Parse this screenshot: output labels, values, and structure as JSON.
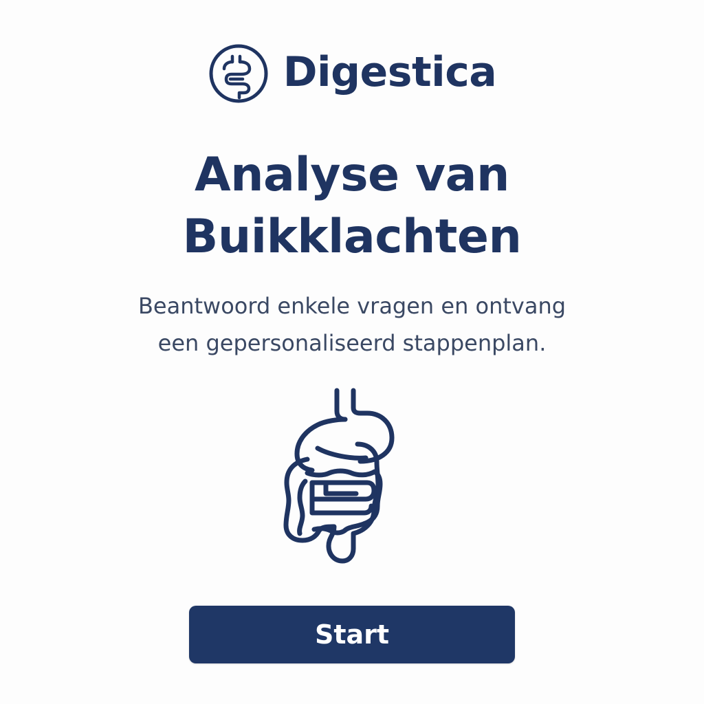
{
  "brand": {
    "name": "Digestica",
    "logo_icon": "digestive-tract-logo-icon"
  },
  "hero": {
    "title_line1": "Analyse van",
    "title_line2": "Buikklachten",
    "subtitle_line1": "Beantwoord enkele vragen en ontvang",
    "subtitle_line2": "een gepersonaliseerd stappenplan."
  },
  "illustration": {
    "icon": "intestines-icon"
  },
  "actions": {
    "start_label": "Start"
  },
  "colors": {
    "primary": "#1f3766",
    "text": "#1f3461",
    "subtext": "#3a4863",
    "background": "#fdfdfd"
  }
}
